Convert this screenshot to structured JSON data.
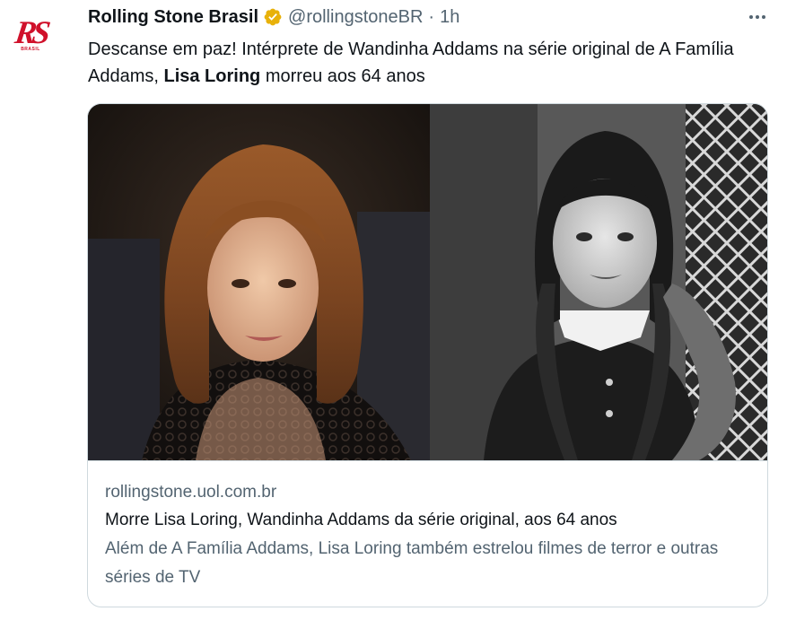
{
  "author": {
    "name": "Rolling Stone Brasil",
    "handle": "@rollingstoneBR",
    "separator": "·",
    "time": "1h",
    "avatar_logo": "RS",
    "avatar_sub": "BRASIL",
    "verified_icon": "verified-badge-icon",
    "accent_color": "#d0112b",
    "badge_color": "#e8b10a"
  },
  "tweet": {
    "text_part1": "Descanse em paz! Intérprete de Wandinha Addams na série original de A Família Addams, ",
    "text_bold": "Lisa Loring",
    "text_part2": " morreu aos 64 anos"
  },
  "card": {
    "domain": "rollingstone.uol.com.br",
    "title": "Morre Lisa Loring, Wandinha Addams da série original, aos 64 anos",
    "description": "Além de A Família Addams, Lisa Loring também estrelou filmes de terror e outras séries de TV"
  }
}
